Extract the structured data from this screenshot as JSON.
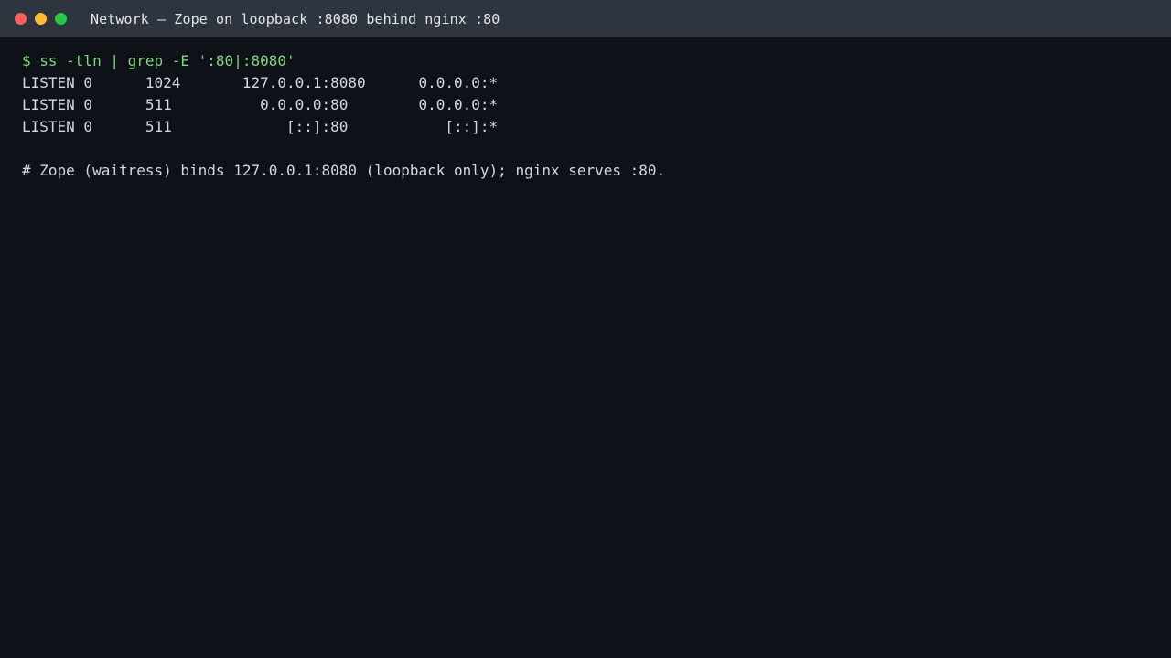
{
  "window": {
    "title": "Network — Zope on loopback :8080 behind nginx :80"
  },
  "terminal": {
    "command": "$ ss -tln | grep -E ':80|:8080'",
    "output": [
      "LISTEN 0      1024       127.0.0.1:8080      0.0.0.0:*",
      "LISTEN 0      511          0.0.0.0:80        0.0.0.0:*",
      "LISTEN 0      511             [::]:80           [::]:*"
    ],
    "comment": "# Zope (waitress) binds 127.0.0.1:8080 (loopback only); nginx serves :80."
  },
  "colors": {
    "background": "#0e1118",
    "titlebar": "#2e353e",
    "command": "#7fd67b",
    "text": "#d4d7dc"
  }
}
